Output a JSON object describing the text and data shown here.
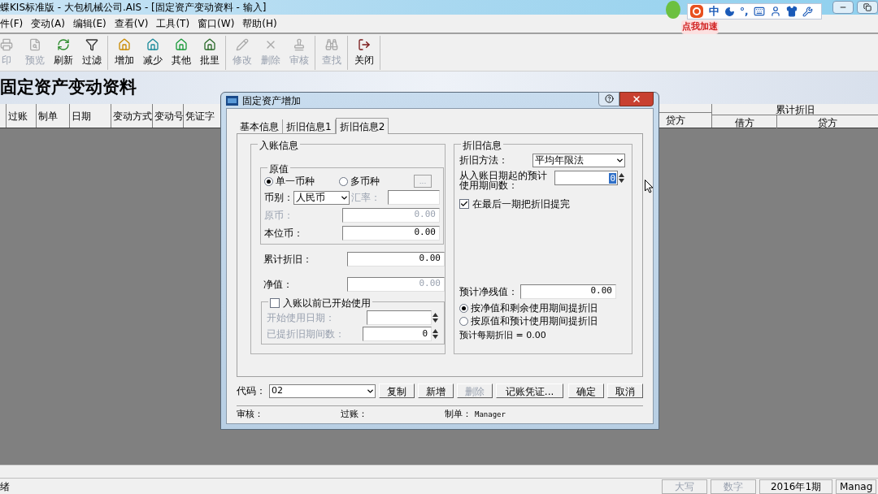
{
  "title_bar": {
    "title": "蝶KIS标准版 - 大包机械公司.AIS - [固定资产变动资料 - 输入]"
  },
  "ime_toolbar": {
    "mode": "中",
    "punctuation": "°,",
    "badge": "点我加速"
  },
  "menu": [
    "件(F)",
    "变动(A)",
    "编辑(E)",
    "查看(V)",
    "工具(T)",
    "窗口(W)",
    "帮助(H)"
  ],
  "toolbar": [
    [
      {
        "label": "印",
        "kind": "print",
        "disabled": true
      },
      {
        "label": "预览",
        "kind": "preview",
        "disabled": true
      },
      {
        "label": "刷新",
        "kind": "refresh",
        "disabled": false
      },
      {
        "label": "过滤",
        "kind": "filter",
        "disabled": false
      }
    ],
    [
      {
        "label": "增加",
        "kind": "add",
        "disabled": false
      },
      {
        "label": "减少",
        "kind": "reduce",
        "disabled": false
      },
      {
        "label": "其他",
        "kind": "other",
        "disabled": false
      },
      {
        "label": "批里",
        "kind": "batch",
        "disabled": false
      }
    ],
    [
      {
        "label": "修改",
        "kind": "edit",
        "disabled": true
      },
      {
        "label": "删除",
        "kind": "delete",
        "disabled": true
      },
      {
        "label": "审核",
        "kind": "audit",
        "disabled": true
      }
    ],
    [
      {
        "label": "查找",
        "kind": "find",
        "disabled": true
      }
    ],
    [
      {
        "label": "关闭",
        "kind": "close",
        "disabled": false
      }
    ]
  ],
  "page_heading": "固定资产变动资料",
  "table": {
    "columns": [
      "",
      "过账",
      "制单",
      "日期",
      "变动方式",
      "变动号",
      "凭证字"
    ],
    "column_8": "贷方",
    "group": {
      "label": "累计折旧",
      "columns": [
        "借方",
        "贷方"
      ]
    }
  },
  "dialog": {
    "title": "固定资产增加",
    "tabs": [
      {
        "label": "基本信息",
        "selected": false
      },
      {
        "label": "折旧信息1",
        "selected": false
      },
      {
        "label": "折旧信息2",
        "selected": true
      }
    ],
    "entry_group": {
      "title": "入账信息",
      "original_value": {
        "title": "原值",
        "currency_modes": [
          {
            "label": "单一币种",
            "selected": true
          },
          {
            "label": "多币种",
            "selected": false
          }
        ],
        "more_button": "...",
        "currency": {
          "label": "币别：",
          "value": "人民币"
        },
        "rate": {
          "label": "汇率："
        },
        "fields": [
          {
            "label": "原币：",
            "value": "0.00",
            "disabled": true
          },
          {
            "label": "本位币：",
            "value": "0.00",
            "disabled": false
          }
        ]
      },
      "fields": [
        {
          "label": "累计折旧：",
          "value": "0.00",
          "disabled": false
        },
        {
          "label": "净值：",
          "value": "0.00",
          "disabled": true
        }
      ],
      "prior_use": {
        "label": "入账以前已开始使用",
        "checked": false,
        "start_date": {
          "label": "开始使用日期："
        },
        "periods": {
          "label": "已提折旧期间数：",
          "value": "0"
        }
      }
    },
    "depreciation_group": {
      "title": "折旧信息",
      "method": {
        "label": "折旧方法：",
        "value": "平均年限法"
      },
      "periods": {
        "label": "从入账日期起的预计使用期间数：",
        "value": "0"
      },
      "last_period": {
        "label": "在最后一期把折旧提完",
        "checked": true
      },
      "residual": {
        "label": "预计净残值：",
        "value": "0.00"
      },
      "bases": [
        {
          "label": "按净值和剩余使用期间提折旧",
          "selected": true
        },
        {
          "label": "按原值和预计使用期间提折旧",
          "selected": false
        }
      ],
      "estimate": "预计每期折旧 = 0.00"
    },
    "code": {
      "label": "代码：",
      "value": "02"
    },
    "buttons": [
      {
        "label": "复制",
        "disabled": false
      },
      {
        "label": "新增",
        "disabled": false
      },
      {
        "label": "删除",
        "disabled": true
      },
      {
        "label": "记账凭证...",
        "disabled": false
      },
      {
        "label": "确定",
        "disabled": false
      },
      {
        "label": "取消",
        "disabled": false
      }
    ],
    "footer": [
      {
        "label": "审核："
      },
      {
        "label": "过账："
      },
      {
        "label": "制单：",
        "value": "Manager"
      }
    ]
  },
  "status_bar": {
    "message": "绪",
    "panes": [
      {
        "label": "大写",
        "disabled": true
      },
      {
        "label": "数字",
        "disabled": true
      },
      {
        "label": "2016年1期",
        "disabled": false
      },
      {
        "label": "Manag",
        "disabled": false
      }
    ]
  }
}
